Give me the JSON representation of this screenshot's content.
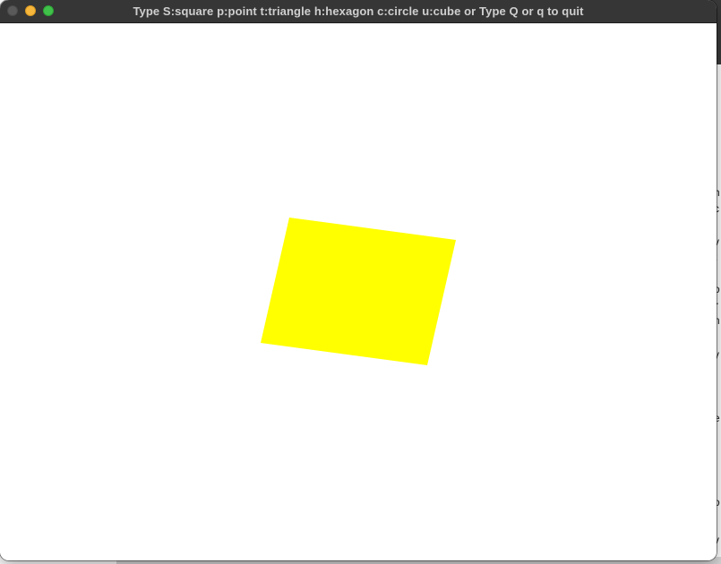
{
  "window": {
    "title": "Type S:square p:point t:triangle h:hexagon c:circle u:cube or Type Q or q to quit"
  },
  "shape": {
    "kind": "square",
    "fill": "#ffff00"
  },
  "colors": {
    "titlebar": "#363636",
    "canvas_background": "#ffffff",
    "close_button": "#5a5a5a",
    "minimize_button": "#f6b73c",
    "zoom_button": "#3fc14a"
  },
  "background_app": {
    "fragments": [
      "i",
      "h",
      "c",
      "v",
      "t",
      "o",
      "r",
      "n",
      "y",
      "e",
      "o",
      "v"
    ]
  }
}
